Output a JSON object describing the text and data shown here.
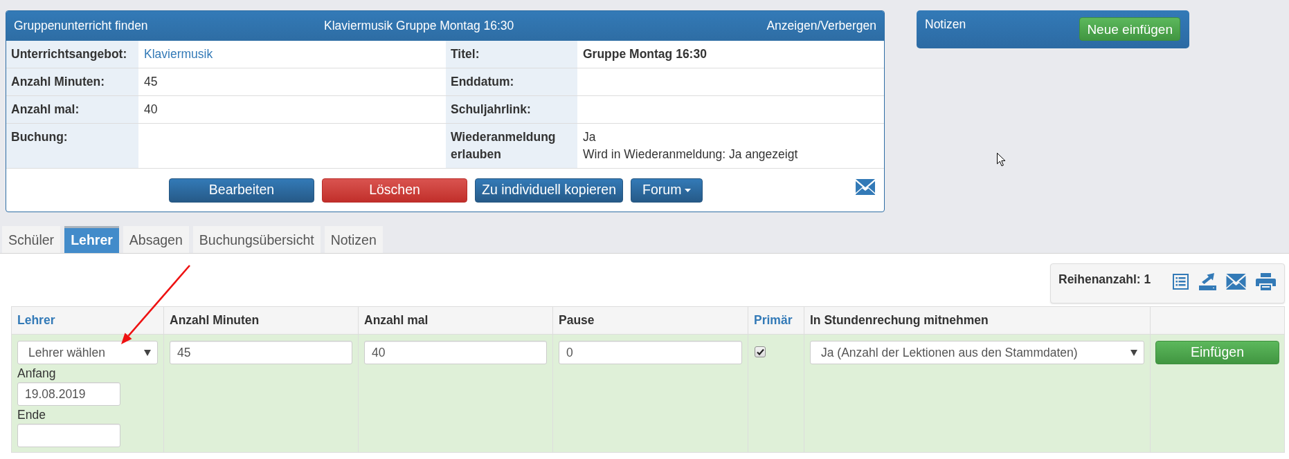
{
  "detail_panel": {
    "title": "Gruppenunterricht finden",
    "subtitle": "Klaviermusik Gruppe Montag 16:30",
    "toggle_link": "Anzeigen/Verbergen",
    "fields": [
      {
        "label": "Unterrichtsangebot:",
        "kind": "link",
        "lines": [
          "Klaviermusik"
        ]
      },
      {
        "label": "Titel:",
        "kind": "bold",
        "lines": [
          "Gruppe Montag 16:30"
        ]
      },
      {
        "label": "Anzahl Minuten:",
        "kind": "text",
        "lines": [
          "45"
        ]
      },
      {
        "label": "Enddatum:"
      },
      {
        "label": "Anzahl mal:",
        "kind": "text",
        "lines": [
          "40"
        ]
      },
      {
        "label": "Schuljahrlink:"
      },
      {
        "label": "Buchung:"
      },
      {
        "label": "Wiederanmeldung erlauben",
        "kind": "text",
        "lines": [
          "Ja",
          "Wird in Wiederanmeldung: Ja angezeigt"
        ]
      }
    ],
    "buttons": [
      {
        "label": "Bearbeiten",
        "kind": "primary"
      },
      {
        "label": "Löschen",
        "kind": "danger"
      },
      {
        "label": "Zu individuell kopieren",
        "kind": "primary"
      },
      {
        "label": "Forum",
        "kind": "dropdown"
      }
    ]
  },
  "notes_panel": {
    "title": "Notizen",
    "button": "Neue einfügen"
  },
  "tabs": [
    {
      "label": "Schüler",
      "selected": false
    },
    {
      "label": "Lehrer",
      "selected": true
    },
    {
      "label": "Absagen",
      "selected": false
    },
    {
      "label": "Buchungsübersicht",
      "selected": false
    },
    {
      "label": "Notizen",
      "selected": false
    }
  ],
  "toolbar": {
    "row_count": "Reihenanzahl: 1"
  },
  "table": {
    "columns": [
      {
        "label": "Lehrer",
        "kind": "link"
      },
      {
        "label": "Anzahl Minuten",
        "kind": "text"
      },
      {
        "label": "Anzahl mal",
        "kind": "text"
      },
      {
        "label": "Pause",
        "kind": "text"
      },
      {
        "label": "Primär",
        "kind": "link"
      },
      {
        "label": "In Stundenrechung mitnehmen",
        "kind": "text"
      }
    ],
    "new_row": {
      "teacher": {
        "value": "Lehrer wählen"
      },
      "start": {
        "label": "Anfang",
        "value": "19.08.2019"
      },
      "end": {
        "label": "Ende"
      },
      "minutes": {
        "value": "45"
      },
      "times": {
        "value": "40"
      },
      "pause": {
        "value": "0"
      },
      "primary": {
        "checked": true
      },
      "billing": {
        "value": "Ja (Anzahl der Lektionen aus den Stammdaten)"
      },
      "submit": "Einfügen"
    }
  }
}
